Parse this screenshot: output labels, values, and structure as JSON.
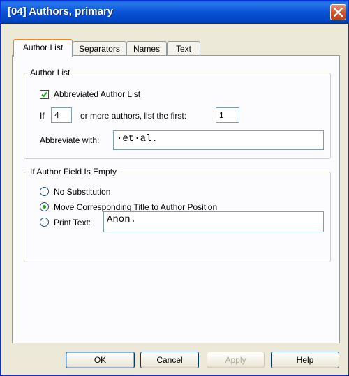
{
  "window": {
    "title": "[04] Authors, primary"
  },
  "tabs": [
    {
      "label": "Author List",
      "active": true
    },
    {
      "label": "Separators",
      "active": false
    },
    {
      "label": "Names",
      "active": false
    },
    {
      "label": "Text",
      "active": false
    }
  ],
  "author_list_group": {
    "legend": "Author List",
    "abbreviated_checkbox": {
      "label": "Abbreviated Author List",
      "checked": true
    },
    "if_label": "If",
    "min_authors_value": "4",
    "or_more_label": "or more authors, list the first:",
    "list_first_value": "1",
    "abbreviate_with_label": "Abbreviate with:",
    "abbreviate_with_value": "·et·al."
  },
  "empty_field_group": {
    "legend": "If Author Field Is Empty",
    "options": [
      {
        "label": "No Substitution",
        "checked": false
      },
      {
        "label": "Move Corresponding Title to Author Position",
        "checked": true
      },
      {
        "label": "Print Text:",
        "checked": false
      }
    ],
    "print_text_value": "Anon."
  },
  "buttons": {
    "ok": "OK",
    "cancel": "Cancel",
    "apply": "Apply",
    "help": "Help"
  },
  "colors": {
    "title_bar": "#0a54d6",
    "dialog_bg": "#ece9d8",
    "tab_highlight": "#e68b2c",
    "close_button": "#d4532a"
  },
  "icons": {
    "close": "close-icon",
    "checkmark": "checkmark-icon"
  }
}
